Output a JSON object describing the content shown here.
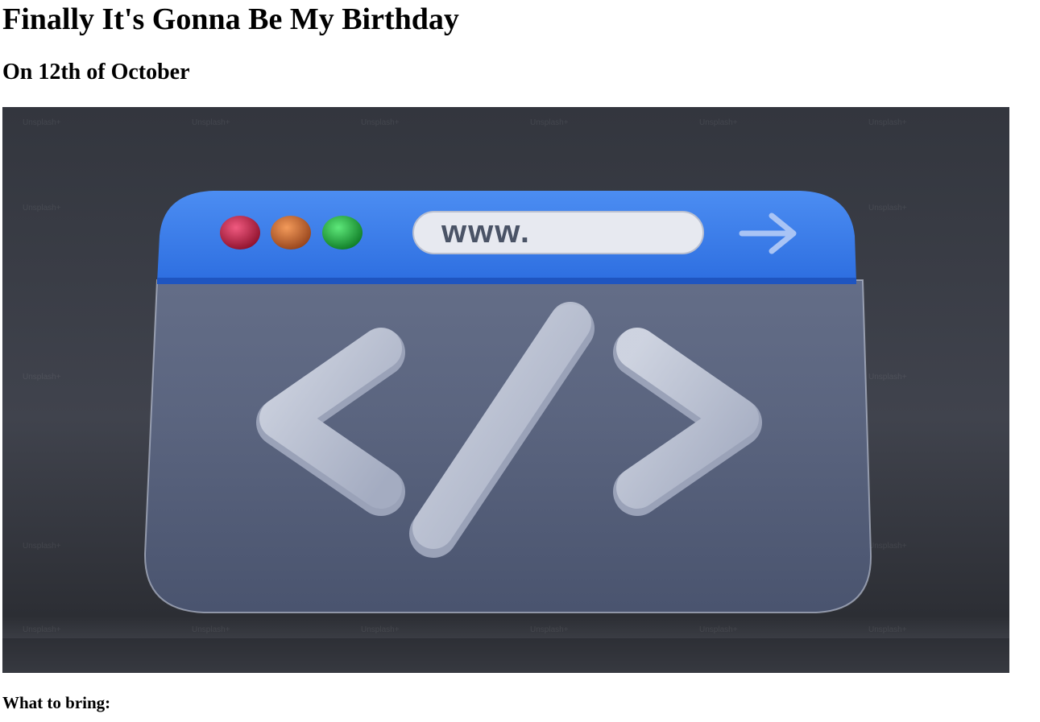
{
  "page": {
    "title": "Finally It's Gonna Be My Birthday",
    "subtitle": "On 12th of October",
    "section_heading": "What to bring:"
  },
  "hero_image": {
    "description_icon": "browser-code-icon",
    "url_bar_text": "www.",
    "watermark_text": "Unsplash+",
    "colors": {
      "background": "#3b3e47",
      "browser_bar": "#3b7ee8",
      "glass_panel": "#5a6683",
      "dot_red": "#b51a3a",
      "dot_orange": "#c4622a",
      "dot_green": "#1fa83a"
    }
  }
}
